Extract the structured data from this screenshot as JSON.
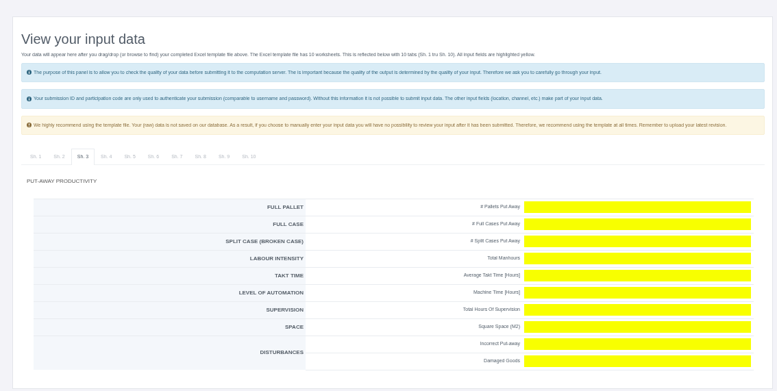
{
  "title": "View your input data",
  "intro": "Your data will appear here after you drag/drop (or browse to find) your completed Excel template file above. The Excel template file has 10 worksheets. This is reflected below with 10 tabs (Sh. 1 tru Sh. 10). All input fields are highlighted yellow.",
  "alerts": [
    {
      "kind": "info",
      "text": "The purpose of this panel is to allow you to check the quality of your data before submitting it to the computation server. The is important because the quality of the output is determined by the quality of your input. Therefore we ask you to carefully go through your input."
    },
    {
      "kind": "info",
      "text": "Your submission ID and participation code are only used to authenticate your submission (comparable to username and password). Without this information it is not possible to submit input data. The other input fields (location, channel, etc.) make part of your input data."
    },
    {
      "kind": "warning",
      "text": "We highly recommend using the template file. Your (raw) data is not saved on our database. As a result, if you choose to manually enter your input data you will have no possibility to review your input after it has been submitted. Therefore, we recommend using the template at all times. Remember to upload your latest revision."
    }
  ],
  "tabs": [
    {
      "label": "Sh. 1",
      "selected": false
    },
    {
      "label": "Sh. 2",
      "selected": false
    },
    {
      "label": "Sh. 3",
      "selected": true
    },
    {
      "label": "Sh. 4",
      "selected": false
    },
    {
      "label": "Sh. 5",
      "selected": false
    },
    {
      "label": "Sh. 6",
      "selected": false
    },
    {
      "label": "Sh. 7",
      "selected": false
    },
    {
      "label": "Sh. 8",
      "selected": false
    },
    {
      "label": "Sh. 9",
      "selected": false
    },
    {
      "label": "Sh. 10",
      "selected": false
    }
  ],
  "section_title": "PUT-AWAY PRODUCTIVITY",
  "groups": [
    {
      "label": "FULL PALLET",
      "fields": [
        "# Pallets Put Away"
      ]
    },
    {
      "label": "FULL CASE",
      "fields": [
        "# Full Cases Put Away"
      ]
    },
    {
      "label": "SPLIT CASE (BROKEN CASE)",
      "fields": [
        "# Split Cases Put Away"
      ]
    },
    {
      "label": "LABOUR INTENSITY",
      "fields": [
        "Total Manhours"
      ]
    },
    {
      "label": "TAKT TIME",
      "fields": [
        "Average Takt Time [Hours]"
      ]
    },
    {
      "label": "LEVEL OF AUTOMATION",
      "fields": [
        "Machine Time [Hours]"
      ]
    },
    {
      "label": "SUPERVISION",
      "fields": [
        "Total Hours Of Supervision"
      ]
    },
    {
      "label": "SPACE",
      "fields": [
        "Square Space (M2)"
      ]
    },
    {
      "label": "DISTURBANCES",
      "fields": [
        "Incorrect Put-away",
        "Damaged Goods"
      ]
    }
  ]
}
